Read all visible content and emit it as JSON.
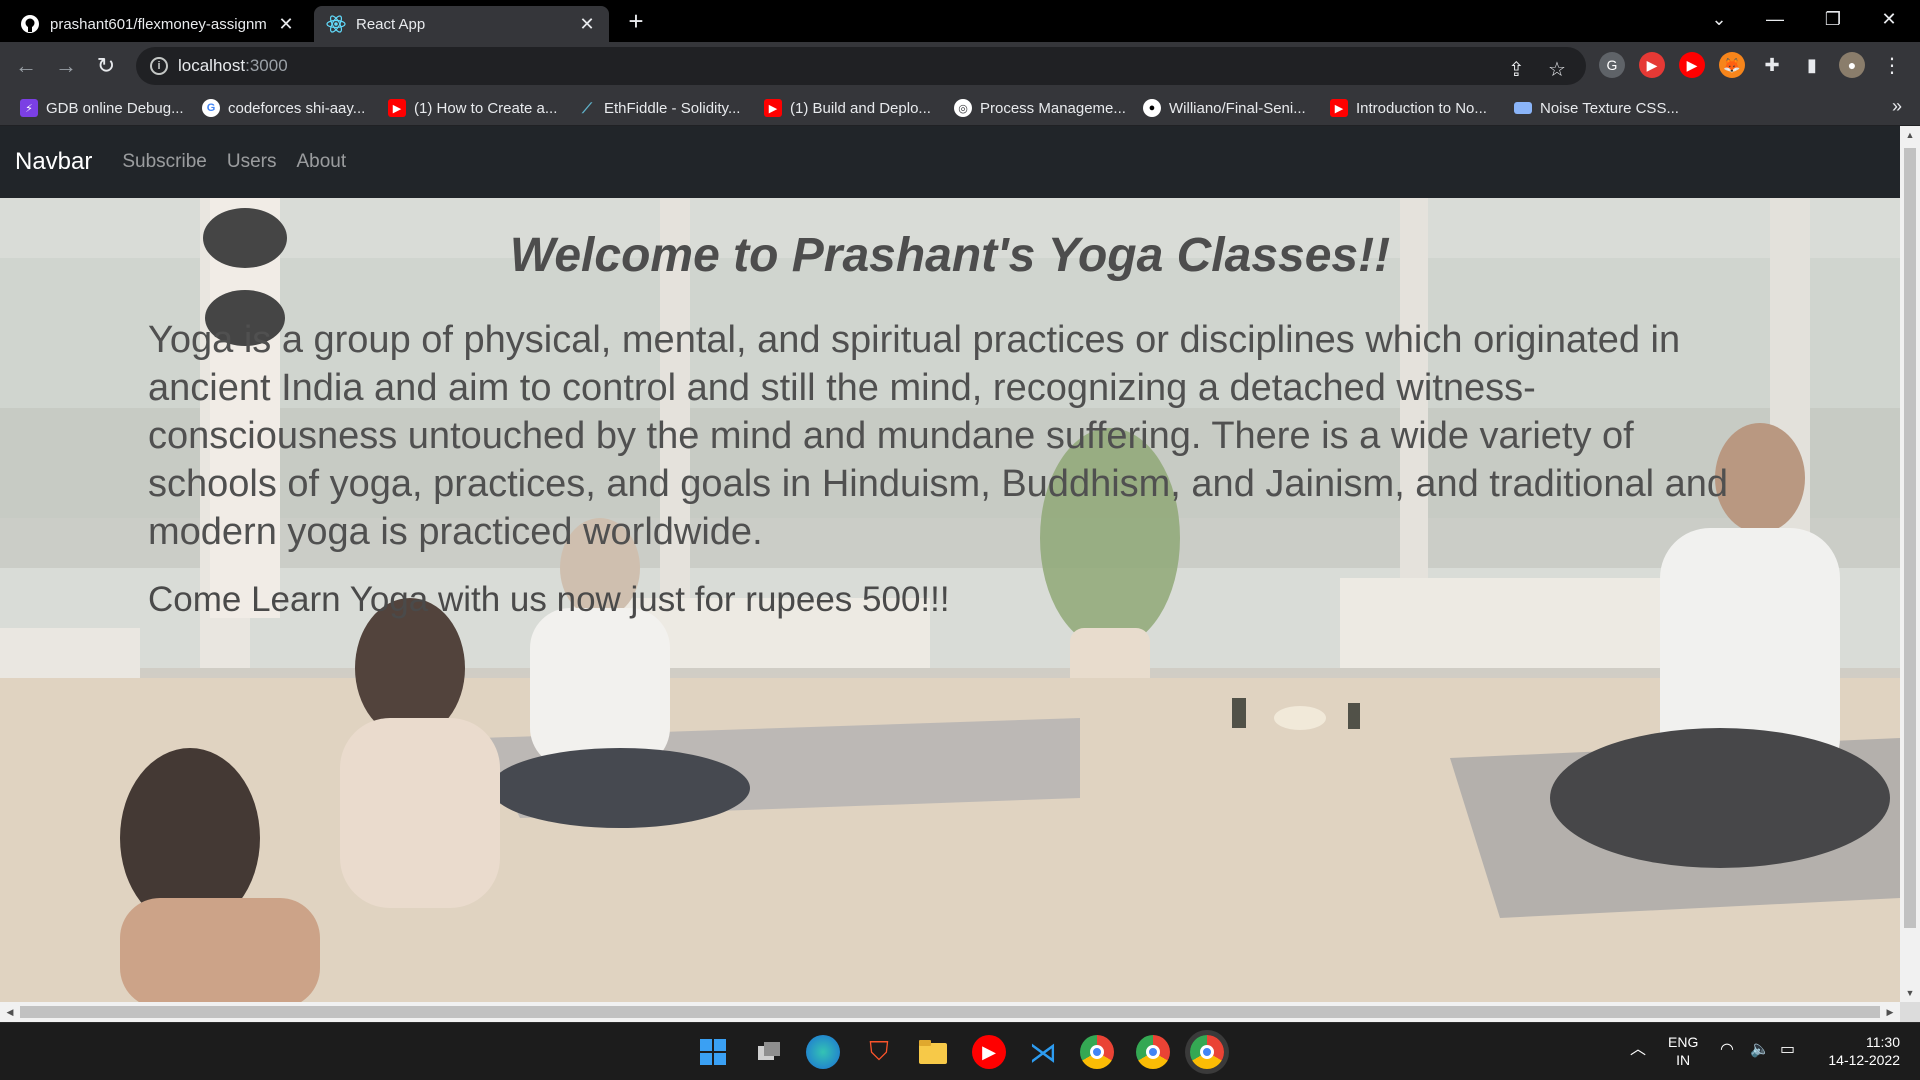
{
  "browser": {
    "tabs": [
      {
        "title": "prashant601/flexmoney-assignm",
        "icon": "github-icon",
        "active": false
      },
      {
        "title": "React App",
        "icon": "react-icon",
        "active": true
      }
    ],
    "url": {
      "host": "localhost",
      "port": ":3000"
    },
    "bookmarks": [
      {
        "label": "GDB online Debug...",
        "icon": "gdb-icon"
      },
      {
        "label": "codeforces shi-aay...",
        "icon": "google-icon"
      },
      {
        "label": "(1) How to Create a...",
        "icon": "youtube-icon"
      },
      {
        "label": "EthFiddle - Solidity...",
        "icon": "ethfiddle-icon"
      },
      {
        "label": "(1) Build and Deplo...",
        "icon": "youtube-icon"
      },
      {
        "label": "Process Manageme...",
        "icon": "globe-icon"
      },
      {
        "label": "Williano/Final-Seni...",
        "icon": "github-icon"
      },
      {
        "label": "Introduction to No...",
        "icon": "youtube-icon"
      },
      {
        "label": "Noise Texture CSS...",
        "icon": "folder-icon"
      }
    ]
  },
  "page": {
    "navbar": {
      "brand": "Navbar",
      "links": [
        "Subscribe",
        "Users",
        "About"
      ]
    },
    "hero": {
      "title": "Welcome to Prashant's Yoga Classes!!",
      "description": "Yoga is a group of physical, mental, and spiritual practices or disciplines which originated in ancient India and aim to control and still the mind, recognizing a detached witness-consciousness untouched by the mind and mundane suffering. There is a wide variety of schools of yoga, practices, and goals in Hinduism, Buddhism, and Jainism, and traditional and modern yoga is practiced worldwide.",
      "offer": "Come Learn Yoga with us now just for rupees 500!!!"
    }
  },
  "taskbar": {
    "apps": [
      "windows-start-icon",
      "task-view-icon",
      "edge-icon",
      "brave-icon",
      "file-explorer-icon",
      "youtube-music-icon",
      "vscode-icon",
      "chrome-icon",
      "chrome-profile-icon",
      "chrome-active-icon"
    ],
    "language": {
      "line1": "ENG",
      "line2": "IN"
    },
    "clock": {
      "time": "11:30",
      "date": "14-12-2022"
    }
  },
  "colors": {
    "navbar_bg": "#212529",
    "chrome_dark": "#35363a",
    "heading_text": "#4d4d4d"
  }
}
